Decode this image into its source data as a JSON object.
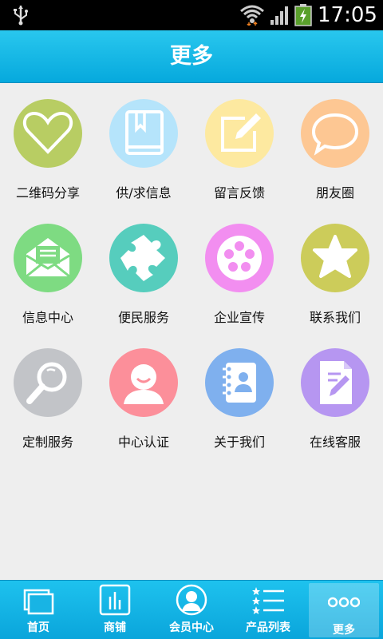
{
  "status_bar": {
    "time": "17:05",
    "icons": [
      "usb-icon",
      "wifi-icon",
      "signal-icon",
      "battery-charging-icon"
    ]
  },
  "header": {
    "title": "更多"
  },
  "grid": {
    "items": [
      {
        "label": "二维码分享",
        "icon": "heart-icon",
        "color": "#b8cd63"
      },
      {
        "label": "供/求信息",
        "icon": "book-icon",
        "color": "#b5e4fb"
      },
      {
        "label": "留言反馈",
        "icon": "edit-icon",
        "color": "#fde9a0"
      },
      {
        "label": "朋友圈",
        "icon": "speech-bubble-icon",
        "color": "#fdc793"
      },
      {
        "label": "信息中心",
        "icon": "envelope-icon",
        "color": "#7edb82"
      },
      {
        "label": "便民服务",
        "icon": "puzzle-icon",
        "color": "#56cdbd"
      },
      {
        "label": "企业宣传",
        "icon": "film-reel-icon",
        "color": "#f28ef0"
      },
      {
        "label": "联系我们",
        "icon": "star-icon",
        "color": "#cccc5a"
      },
      {
        "label": "定制服务",
        "icon": "magnifier-icon",
        "color": "#c2c4c8"
      },
      {
        "label": "中心认证",
        "icon": "user-face-icon",
        "color": "#fc8f9a"
      },
      {
        "label": "关于我们",
        "icon": "contact-book-icon",
        "color": "#7fb0ee"
      },
      {
        "label": "在线客服",
        "icon": "document-edit-icon",
        "color": "#b696f1"
      }
    ]
  },
  "tabbar": {
    "tabs": [
      {
        "label": "首页",
        "icon": "home-windows-icon"
      },
      {
        "label": "商铺",
        "icon": "shop-bars-icon"
      },
      {
        "label": "会员中心",
        "icon": "member-avatar-icon"
      },
      {
        "label": "产品列表",
        "icon": "star-list-icon"
      },
      {
        "label": "更多",
        "icon": "more-dots-icon"
      }
    ],
    "active_index": 4
  }
}
